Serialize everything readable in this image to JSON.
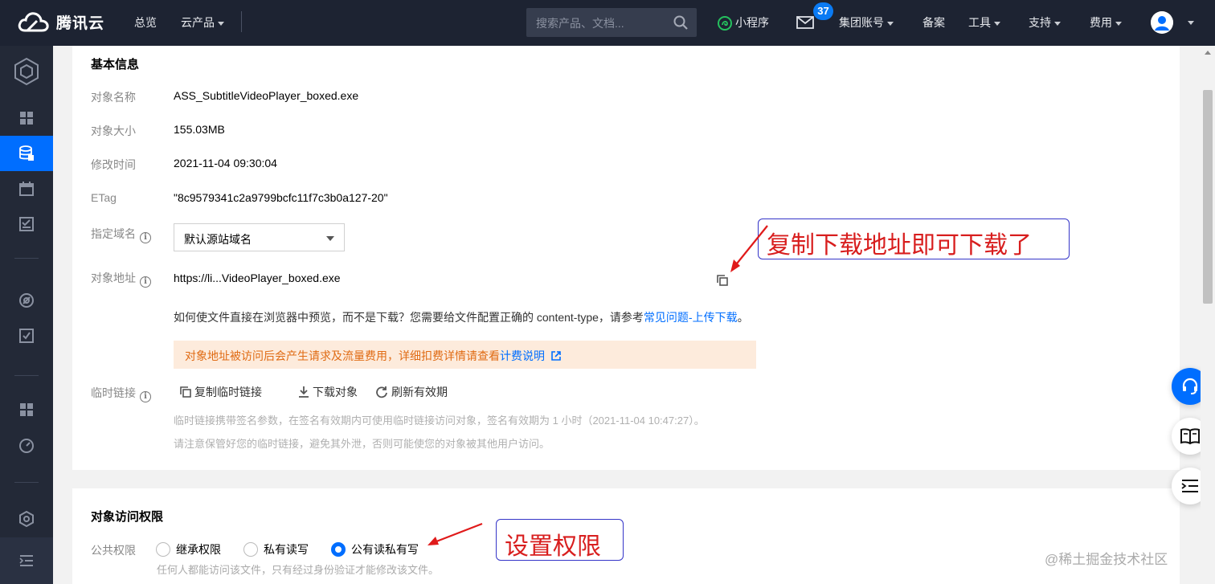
{
  "topbar": {
    "logo_text": "腾讯云",
    "nav": [
      "总览",
      "云产品"
    ],
    "search_placeholder": "搜索产品、文档...",
    "mini_program": "小程序",
    "mail_badge": "37",
    "group_account": "集团账号",
    "beian": "备案",
    "tools": "工具",
    "support": "支持",
    "fees": "费用"
  },
  "basic": {
    "title": "基本信息",
    "labels": {
      "name": "对象名称",
      "size": "对象大小",
      "mtime": "修改时间",
      "etag": "ETag",
      "domain": "指定域名",
      "address": "对象地址",
      "temp_link": "临时链接"
    },
    "values": {
      "name": "ASS_SubtitleVideoPlayer_boxed.exe",
      "size": "155.03MB",
      "mtime": "2021-11-04 09:30:04",
      "etag": "\"8c9579341c2a9799bcfc11f7c3b0a127-20\"",
      "domain": "默认源站域名",
      "address": "https://li...VideoPlayer_boxed.exe"
    },
    "preview_text": "如何使文件直接在浏览器中预览，而不是下载？您需要给文件配置正确的 content-type，请参考",
    "preview_link": "常见问题-上传下载",
    "preview_end": "。",
    "notice_text": "对象地址被访问后会产生请求及流量费用，详细扣费详情请查看",
    "notice_link": "计费说明",
    "actions": [
      "复制临时链接",
      "下载对象",
      "刷新有效期"
    ],
    "hint1": "临时链接携带签名参数，在签名有效期内可使用临时链接访问对象，签名有效期为 1 小时（2021-11-04 10:47:27）。",
    "hint2": "请注意保管好您的临时链接，避免其外泄，否则可能使您的对象被其他用户访问。"
  },
  "access": {
    "title": "对象访问权限",
    "label": "公共权限",
    "options": [
      "继承权限",
      "私有读写",
      "公有读私有写"
    ],
    "selected": 2,
    "hint": "任何人都能访问该文件，只有经过身份验证才能修改该文件。"
  },
  "annotations": {
    "download": "复制下载地址即可下载了",
    "permission": "设置权限"
  },
  "watermark": "@稀土掘金技术社区"
}
